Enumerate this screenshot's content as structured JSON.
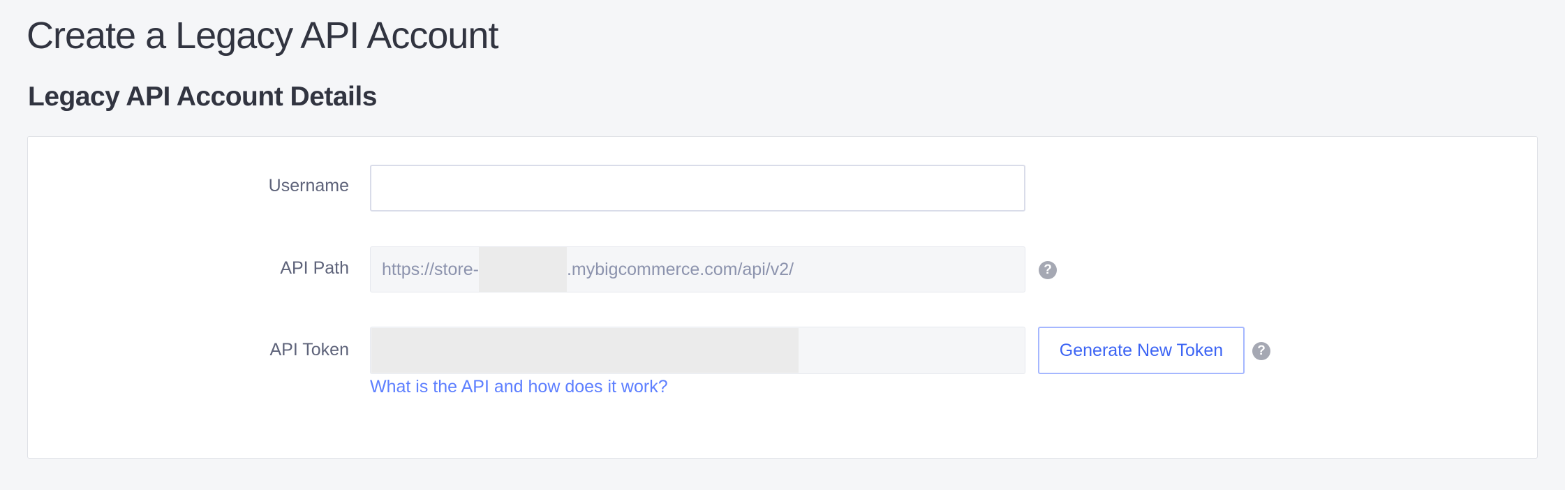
{
  "page": {
    "title": "Create a Legacy API Account",
    "section_heading": "Legacy API Account Details"
  },
  "form": {
    "username": {
      "label": "Username",
      "value": "",
      "placeholder": ""
    },
    "api_path": {
      "label": "API Path",
      "prefix": "https://store-",
      "suffix": ".mybigcommerce.com/api/v2/"
    },
    "api_token": {
      "label": "API Token",
      "value": ""
    },
    "generate_button": "Generate New Token",
    "help_icon": "?",
    "help_link": "What is the API and how does it work?"
  },
  "colors": {
    "accent": "#5d7fff",
    "button_border": "#a5b7ff",
    "redaction": "#ebebeb"
  }
}
